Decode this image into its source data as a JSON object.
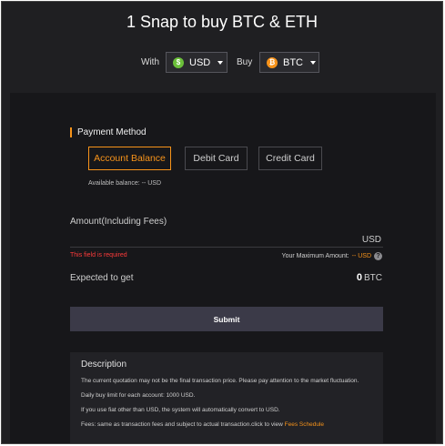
{
  "hero": {
    "title": "1 Snap to buy BTC & ETH"
  },
  "selectors": {
    "with_label": "With",
    "fiat": {
      "symbol": "$",
      "value": "USD"
    },
    "buy_label": "Buy",
    "crypto": {
      "symbol": "₿",
      "value": "BTC"
    }
  },
  "payment": {
    "section_title": "Payment Method",
    "methods": [
      "Account Balance",
      "Debit Card",
      "Credit Card"
    ],
    "selected": "Account Balance",
    "available_balance": "Available balance: -- USD"
  },
  "amount": {
    "label": "Amount(Including Fees)",
    "value": "",
    "unit": "USD",
    "error": "This field is required",
    "max_label": "Your Maximum Amount:",
    "max_value": "-- USD"
  },
  "expected": {
    "label": "Expected to get",
    "value": "0",
    "unit": "BTC"
  },
  "submit_label": "Submit",
  "description": {
    "title": "Description",
    "paragraphs": [
      "The current quotation may not be the final transaction price. Please pay attention to the market fluctuation.",
      "Daily buy limit for each account: 1000 USD.",
      "If you use fiat other than USD, the system will automatically convert to USD."
    ],
    "fees_text": "Fees: same as transaction fees and subject to actual transaction.click to view",
    "fees_link": "Fees Schedule"
  },
  "colors": {
    "accent": "#f7931a",
    "usd_coin": "#6bbf3a",
    "btc_coin": "#f7931a",
    "error": "#ff3b3b"
  }
}
